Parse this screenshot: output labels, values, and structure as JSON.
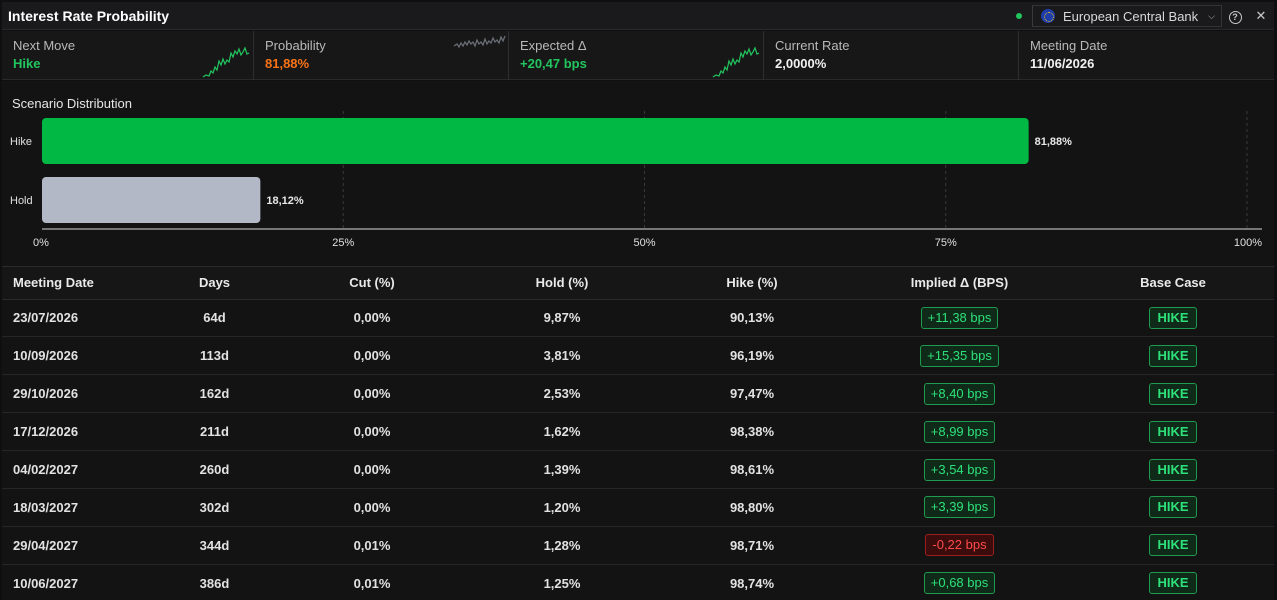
{
  "window": {
    "title": "Interest Rate Probability",
    "bank_selector": "European Central Bank",
    "status_color": "#22c55e",
    "icons": [
      "status-dot",
      "eu-flag-icon",
      "chevron-down-icon",
      "help-icon",
      "close-icon"
    ]
  },
  "stats": [
    {
      "label": "Next Move",
      "value": "Hike",
      "color": "green",
      "spark": "up"
    },
    {
      "label": "Probability",
      "value": "81,88%",
      "color": "orange",
      "spark": "flat"
    },
    {
      "label": "Expected Δ",
      "value": "+20,47 bps",
      "color": "green",
      "spark": "up"
    },
    {
      "label": "Current Rate",
      "value": "2,0000%",
      "color": "white",
      "spark": null
    },
    {
      "label": "Meeting Date",
      "value": "11/06/2026",
      "color": "white",
      "spark": null
    }
  ],
  "distribution": {
    "title": "Scenario Distribution",
    "chart_data": {
      "type": "bar",
      "orientation": "horizontal",
      "categories": [
        "Hike",
        "Hold"
      ],
      "values": [
        81.88,
        18.12
      ],
      "value_labels": [
        "81,88%",
        "18,12%"
      ],
      "colors": [
        "#00b843",
        "#b3b8c6"
      ],
      "x_ticks": [
        "0%",
        "25%",
        "50%",
        "75%",
        "100%"
      ],
      "xlim": [
        0,
        100
      ],
      "grid": true
    }
  },
  "table": {
    "headers": [
      "Meeting Date",
      "Days",
      "Cut (%)",
      "Hold (%)",
      "Hike (%)",
      "Implied Δ (BPS)",
      "Base Case"
    ],
    "rows": [
      {
        "date": "23/07/2026",
        "days": "64d",
        "cut": "0,00%",
        "hold": "9,87%",
        "hike": "90,13%",
        "implied": "+11,38 bps",
        "sign": "pos",
        "base": "HIKE"
      },
      {
        "date": "10/09/2026",
        "days": "113d",
        "cut": "0,00%",
        "hold": "3,81%",
        "hike": "96,19%",
        "implied": "+15,35 bps",
        "sign": "pos",
        "base": "HIKE"
      },
      {
        "date": "29/10/2026",
        "days": "162d",
        "cut": "0,00%",
        "hold": "2,53%",
        "hike": "97,47%",
        "implied": "+8,40 bps",
        "sign": "pos",
        "base": "HIKE"
      },
      {
        "date": "17/12/2026",
        "days": "211d",
        "cut": "0,00%",
        "hold": "1,62%",
        "hike": "98,38%",
        "implied": "+8,99 bps",
        "sign": "pos",
        "base": "HIKE"
      },
      {
        "date": "04/02/2027",
        "days": "260d",
        "cut": "0,00%",
        "hold": "1,39%",
        "hike": "98,61%",
        "implied": "+3,54 bps",
        "sign": "pos",
        "base": "HIKE"
      },
      {
        "date": "18/03/2027",
        "days": "302d",
        "cut": "0,00%",
        "hold": "1,20%",
        "hike": "98,80%",
        "implied": "+3,39 bps",
        "sign": "pos",
        "base": "HIKE"
      },
      {
        "date": "29/04/2027",
        "days": "344d",
        "cut": "0,01%",
        "hold": "1,28%",
        "hike": "98,71%",
        "implied": "-0,22 bps",
        "sign": "neg",
        "base": "HIKE"
      },
      {
        "date": "10/06/2027",
        "days": "386d",
        "cut": "0,01%",
        "hold": "1,25%",
        "hike": "98,74%",
        "implied": "+0,68 bps",
        "sign": "pos",
        "base": "HIKE"
      }
    ]
  }
}
